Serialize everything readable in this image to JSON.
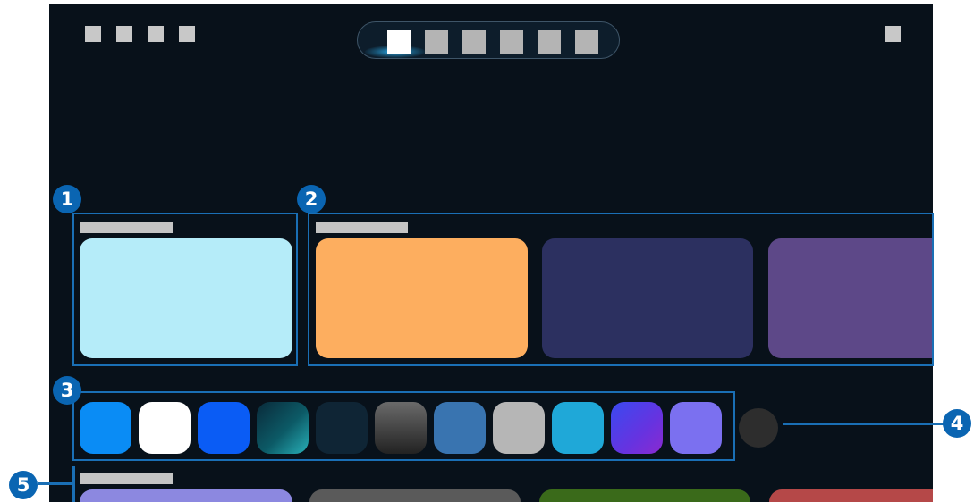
{
  "screen": {
    "top_left_icons": [
      "placeholder-square-icon",
      "placeholder-square-icon",
      "placeholder-square-icon",
      "placeholder-square-icon"
    ],
    "top_right_icon": "placeholder-square-icon",
    "tabs": [
      {
        "state": "selected",
        "color": "#ffffff"
      },
      {
        "state": "normal",
        "color": "#b4b4b4"
      },
      {
        "state": "normal",
        "color": "#b4b4b4"
      },
      {
        "state": "normal",
        "color": "#b4b4b4"
      },
      {
        "state": "normal",
        "color": "#b4b4b4"
      },
      {
        "state": "normal",
        "color": "#b4b4b4"
      }
    ],
    "section1": {
      "label_placeholder": true,
      "card_color": "#b5ecf9"
    },
    "section2": {
      "label_placeholder": true,
      "card_colors": [
        "#fdae5f",
        "#2c3060",
        "#5d4888"
      ]
    },
    "app_row": {
      "app_colors": [
        "#0a8cf5",
        "#ffffff",
        "#0a5cf5",
        "#0c5a66",
        "#0f2535",
        "#3e3e3e",
        "#3974b0",
        "#b6b6b6",
        "#1fa8d8",
        "#6633e0",
        "#7b70f0"
      ],
      "more_button_color": "#2d2d2d"
    },
    "section5": {
      "label_placeholder": true,
      "card_colors": [
        "#8c88e0",
        "#5a5a5a",
        "#3a6a1a",
        "#b54848"
      ]
    }
  },
  "callouts": {
    "c1": "1",
    "c2": "2",
    "c3": "3",
    "c4": "4",
    "c5": "5"
  },
  "colors": {
    "screen_bg": "#08111a",
    "callout_fill": "#0a65b2",
    "frame_stroke": "#1a6fb5"
  }
}
